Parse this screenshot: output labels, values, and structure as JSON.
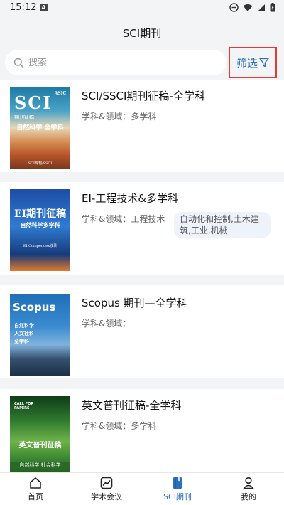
{
  "status_bar": {
    "time": "15:12",
    "notification_letter": "A"
  },
  "header": {
    "title": "SCI期刊"
  },
  "search": {
    "placeholder": "搜索",
    "value": ""
  },
  "filter": {
    "label": "筛选"
  },
  "field_prefix": "学科&领域：",
  "journals": [
    {
      "title": "SCI/SSCI期刊征稿-全学科",
      "fields": [
        "多学科"
      ],
      "cover": {
        "line1": "SCI",
        "line2": "期刊征稿",
        "line3": "自然科学 全学科",
        "footer": "SCI专刊/SSCI",
        "brand": "ASIC"
      }
    },
    {
      "title": "EI-工程技术&多学科",
      "fields": [
        "工程技术",
        "自动化和控制,土木建筑,工业,机械"
      ],
      "cover": {
        "line1": "EI期刊征稿",
        "line2": "自然科学多学科",
        "line3": "EI Compendex收录"
      }
    },
    {
      "title": "Scopus 期刊—全学科",
      "fields": [],
      "cover": {
        "line1": "Scopus",
        "line2": "自然科学",
        "line3": "人文社科",
        "line4": "全学科"
      }
    },
    {
      "title": "英文普刊征稿-全学科",
      "fields": [
        "多学科"
      ],
      "cover": {
        "line1": "CALL FOR PAPERS",
        "line2": "英文普刊征稿",
        "line3": "自然科学 社会科学"
      }
    }
  ],
  "tabs": [
    {
      "label": "首页",
      "icon": "home-icon",
      "active": false
    },
    {
      "label": "学术会议",
      "icon": "chart-icon",
      "active": false
    },
    {
      "label": "SCI期刊",
      "icon": "book-icon",
      "active": true
    },
    {
      "label": "我的",
      "icon": "person-icon",
      "active": false
    }
  ],
  "colors": {
    "accent": "#2c6fbf",
    "highlight_border": "#e53935",
    "background": "#f3f4f6"
  }
}
